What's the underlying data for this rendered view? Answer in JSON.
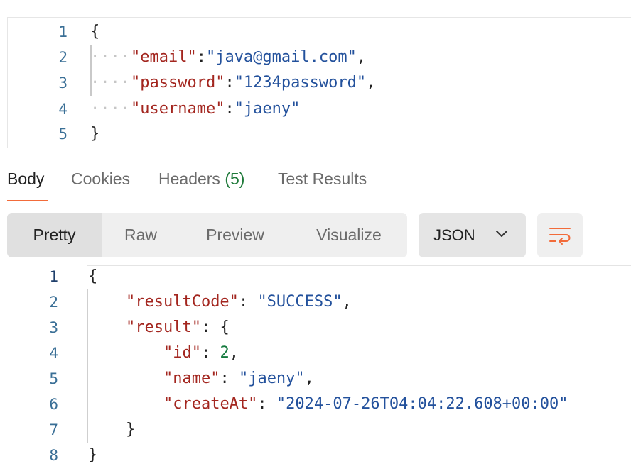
{
  "request_editor": {
    "lines": [
      {
        "number": "1",
        "text": "{"
      },
      {
        "number": "2",
        "indent": "····",
        "key": "\"email\"",
        "sep": ":",
        "value": "\"java@gmail.com\"",
        "tail": ","
      },
      {
        "number": "3",
        "indent": "····",
        "key": "\"password\"",
        "sep": ":",
        "value": "\"1234password\"",
        "tail": ","
      },
      {
        "number": "4",
        "indent": "····",
        "key": "\"username\"",
        "sep": ":",
        "value": "\"jaeny\"",
        "tail": ""
      },
      {
        "number": "5",
        "text": "}"
      }
    ]
  },
  "response_tabs": {
    "body": "Body",
    "cookies": "Cookies",
    "headers": "Headers",
    "headers_count": "(5)",
    "test_results": "Test Results"
  },
  "view_modes": {
    "pretty": "Pretty",
    "raw": "Raw",
    "preview": "Preview",
    "visualize": "Visualize"
  },
  "format": {
    "selected": "JSON"
  },
  "response_body": {
    "lines": [
      {
        "number": "1",
        "open": "{"
      },
      {
        "number": "2",
        "indent": "    ",
        "key": "\"resultCode\"",
        "sep": ": ",
        "value": "\"SUCCESS\"",
        "tail": ","
      },
      {
        "number": "3",
        "indent": "    ",
        "key": "\"result\"",
        "sep": ": ",
        "open": "{"
      },
      {
        "number": "4",
        "indent": "        ",
        "key": "\"id\"",
        "sep": ": ",
        "num": "2",
        "tail": ","
      },
      {
        "number": "5",
        "indent": "        ",
        "key": "\"name\"",
        "sep": ": ",
        "value": "\"jaeny\"",
        "tail": ","
      },
      {
        "number": "6",
        "indent": "        ",
        "key": "\"createAt\"",
        "sep": ": ",
        "value": "\"2024-07-26T04:04:22.608+00:00\""
      },
      {
        "number": "7",
        "indent": "    ",
        "close": "}"
      },
      {
        "number": "8",
        "close": "}"
      }
    ]
  },
  "colors": {
    "accent": "#f26b3a",
    "key": "#a3261f",
    "string": "#23519c",
    "number": "#147a3e",
    "line_number": "#3a6f96"
  },
  "icons": {
    "dropdown": "chevron-down-icon",
    "wrap": "word-wrap-icon"
  }
}
